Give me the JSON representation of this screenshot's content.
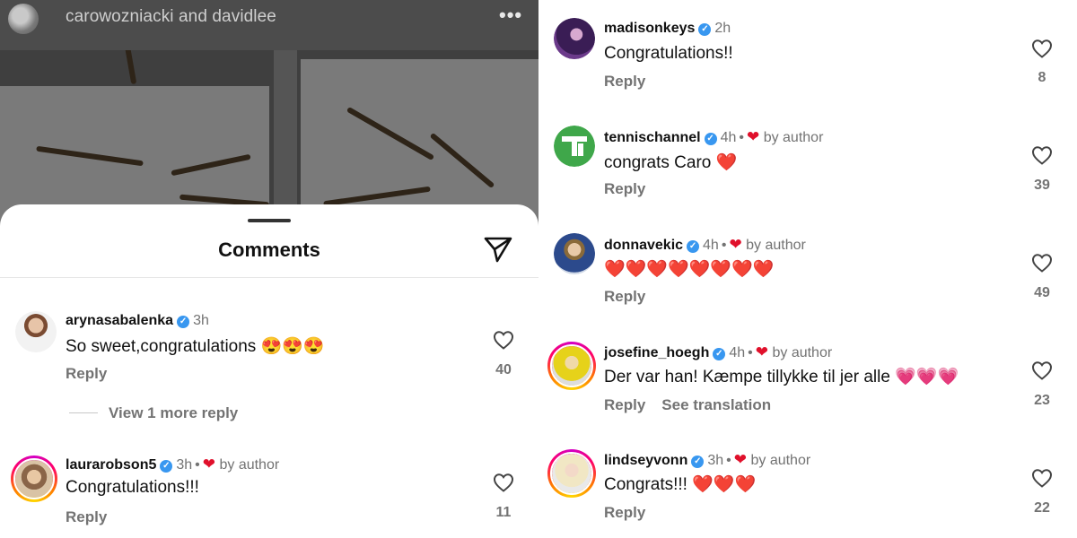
{
  "post": {
    "title": "carowozniacki and davidlee",
    "more_icon": "more-horizontal-icon"
  },
  "sheet": {
    "title": "Comments",
    "share_icon": "send-icon"
  },
  "colors": {
    "verified": "#3897f0",
    "heart": "#e0102b",
    "pink_heart": "#ff3bb0",
    "muted_text": "#737373"
  },
  "left_comments": [
    {
      "username": "arynasabalenka",
      "verified": true,
      "time": "3h",
      "by_author": false,
      "text": "So sweet,congratulations 😍😍😍",
      "reply_label": "Reply",
      "likes": "40",
      "view_replies": "View 1 more reply"
    },
    {
      "username": "laurarobson5",
      "verified": true,
      "time": "3h",
      "by_author": true,
      "author_label": "by author",
      "text": "Congratulations!!!",
      "reply_label": "Reply",
      "likes": "11"
    }
  ],
  "right_comments": [
    {
      "username": "madisonkeys",
      "verified": true,
      "time": "2h",
      "by_author": false,
      "text": "Congratulations!!",
      "reply_label": "Reply",
      "likes": "8"
    },
    {
      "username": "tennischannel",
      "verified": true,
      "time": "4h",
      "by_author": true,
      "author_label": "by author",
      "text": "congrats Caro ❤️",
      "reply_label": "Reply",
      "likes": "39"
    },
    {
      "username": "donnavekic",
      "verified": true,
      "time": "4h",
      "by_author": true,
      "author_label": "by author",
      "text": "❤️❤️❤️❤️❤️❤️❤️❤️",
      "reply_label": "Reply",
      "likes": "49"
    },
    {
      "username": "josefine_hoegh",
      "verified": true,
      "time": "4h",
      "by_author": true,
      "author_label": "by author",
      "text": "Der var han! Kæmpe tillykke til jer alle 💗💗💗",
      "reply_label": "Reply",
      "translate_label": "See translation",
      "likes": "23"
    },
    {
      "username": "lindseyvonn",
      "verified": true,
      "time": "3h",
      "by_author": true,
      "author_label": "by author",
      "text": "Congrats!!! ❤️❤️❤️",
      "reply_label": "Reply",
      "likes": "22"
    }
  ]
}
